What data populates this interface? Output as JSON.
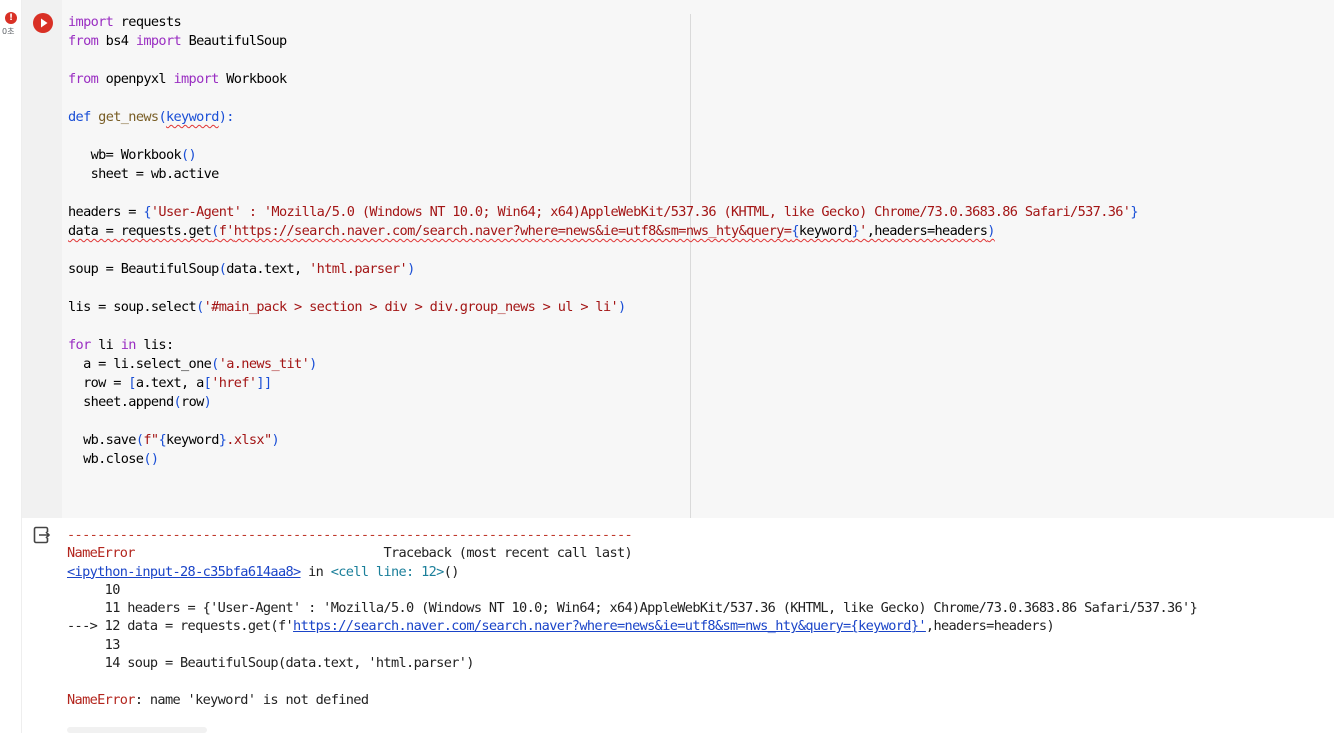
{
  "gutter": {
    "error_badge": "!",
    "exec_time": "0초"
  },
  "cell": {
    "code_lines": [
      [
        [
          "import",
          "kw"
        ],
        [
          " requests",
          ""
        ]
      ],
      [
        [
          "from",
          "kw"
        ],
        [
          " bs4 ",
          ""
        ],
        [
          "import",
          "kw"
        ],
        [
          " BeautifulSoup",
          ""
        ]
      ],
      [],
      [
        [
          "from",
          "kw"
        ],
        [
          " openpyxl ",
          ""
        ],
        [
          "import",
          "kw"
        ],
        [
          " Workbook",
          ""
        ]
      ],
      [],
      [
        [
          "def",
          "kb"
        ],
        [
          " ",
          ""
        ],
        [
          "get_news",
          "fn"
        ],
        [
          "(",
          "par"
        ],
        [
          "keyword",
          "kb squig"
        ],
        [
          "):",
          "par"
        ]
      ],
      [],
      [
        [
          "   wb= Workbook",
          ""
        ],
        [
          "()",
          "par"
        ]
      ],
      [
        [
          "   sheet = wb.active",
          ""
        ]
      ],
      [],
      [
        [
          "headers = ",
          ""
        ],
        [
          "{",
          "par"
        ],
        [
          "'User-Agent' : 'Mozilla/5.0 (Windows NT 10.0; Win64; x64)AppleWebKit/537.36 (KHTML, like Gecko) Chrome/73.0.3683.86 Safari/537.36'",
          "str"
        ],
        [
          "}",
          "par"
        ]
      ],
      [
        [
          "data = requests.get",
          "squig"
        ],
        [
          "(",
          "par squig"
        ],
        [
          "f'",
          "str squig"
        ],
        [
          "https://search.naver.com/search.naver?where=news&ie=utf8&sm=nws_hty&query=",
          "str squig"
        ],
        [
          "{",
          "par squig"
        ],
        [
          "keyword",
          "squig"
        ],
        [
          "}",
          "par squig"
        ],
        [
          "'",
          "str squig"
        ],
        [
          ",headers=headers",
          "squig"
        ],
        [
          ")",
          "par squig"
        ]
      ],
      [],
      [
        [
          "soup = BeautifulSoup",
          ""
        ],
        [
          "(",
          "par"
        ],
        [
          "data.text, ",
          ""
        ],
        [
          "'html.parser'",
          "str"
        ],
        [
          ")",
          "par"
        ]
      ],
      [],
      [
        [
          "lis = soup.select",
          ""
        ],
        [
          "(",
          "par"
        ],
        [
          "'#main_pack > section > div > div.group_news > ul > li'",
          "str"
        ],
        [
          ")",
          "par"
        ]
      ],
      [],
      [
        [
          "for",
          "kw"
        ],
        [
          " li ",
          ""
        ],
        [
          "in",
          "kw"
        ],
        [
          " lis:",
          ""
        ]
      ],
      [
        [
          "  a = li.select_one",
          ""
        ],
        [
          "(",
          "par"
        ],
        [
          "'a.news_tit'",
          "str"
        ],
        [
          ")",
          "par"
        ]
      ],
      [
        [
          "  row = ",
          ""
        ],
        [
          "[",
          "par"
        ],
        [
          "a.text, a",
          ""
        ],
        [
          "[",
          "par"
        ],
        [
          "'href'",
          "str"
        ],
        [
          "]]",
          "par"
        ]
      ],
      [
        [
          "  sheet.append",
          ""
        ],
        [
          "(",
          "par"
        ],
        [
          "row",
          ""
        ],
        [
          ")",
          "par"
        ]
      ],
      [],
      [
        [
          "  wb.save",
          ""
        ],
        [
          "(",
          "par"
        ],
        [
          "f\"",
          "str"
        ],
        [
          "{",
          "par"
        ],
        [
          "keyword",
          ""
        ],
        [
          "}",
          "par"
        ],
        [
          ".xlsx\"",
          "str"
        ],
        [
          ")",
          "par"
        ]
      ],
      [
        [
          "  wb.close",
          ""
        ],
        [
          "()",
          "par"
        ]
      ]
    ]
  },
  "output": {
    "lines": [
      [
        [
          "---------------------------------------------------------------------------",
          "dash"
        ]
      ],
      [
        [
          "NameError",
          "err"
        ],
        [
          "                                 Traceback (most recent call last)",
          ""
        ]
      ],
      [
        [
          "<ipython-input-28-c35bfa614aa8>",
          "lnk"
        ],
        [
          " in ",
          ""
        ],
        [
          "<cell line: 12>",
          "cyan"
        ],
        [
          "()",
          ""
        ]
      ],
      [
        [
          "     10",
          ""
        ]
      ],
      [
        [
          "     11 headers = {'User-Agent' : 'Mozilla/5.0 (Windows NT 10.0; Win64; x64)AppleWebKit/537.36 (KHTML, like Gecko) Chrome/73.0.3683.86 Safari/537.36'}",
          ""
        ]
      ],
      [
        [
          "---> 12 data = requests.get(f'",
          ""
        ],
        [
          "https://search.naver.com/search.naver?where=news&ie=utf8&sm=nws_hty&query={keyword}'",
          "lnk"
        ],
        [
          ",headers=headers)",
          ""
        ]
      ],
      [
        [
          "     13",
          ""
        ]
      ],
      [
        [
          "     14 soup = BeautifulSoup(data.text, 'html.parser')",
          ""
        ]
      ],
      [],
      [
        [
          "NameError",
          "err"
        ],
        [
          ": name 'keyword' is not defined",
          ""
        ]
      ]
    ]
  },
  "colors": {
    "run_button": "#d93025",
    "error_text": "#b3261e",
    "link": "#1a44c8",
    "keyword": "#9a2ec2"
  },
  "icons": {
    "run": "play-circle-icon",
    "output": "output-exit-icon",
    "error": "error-badge-icon"
  }
}
